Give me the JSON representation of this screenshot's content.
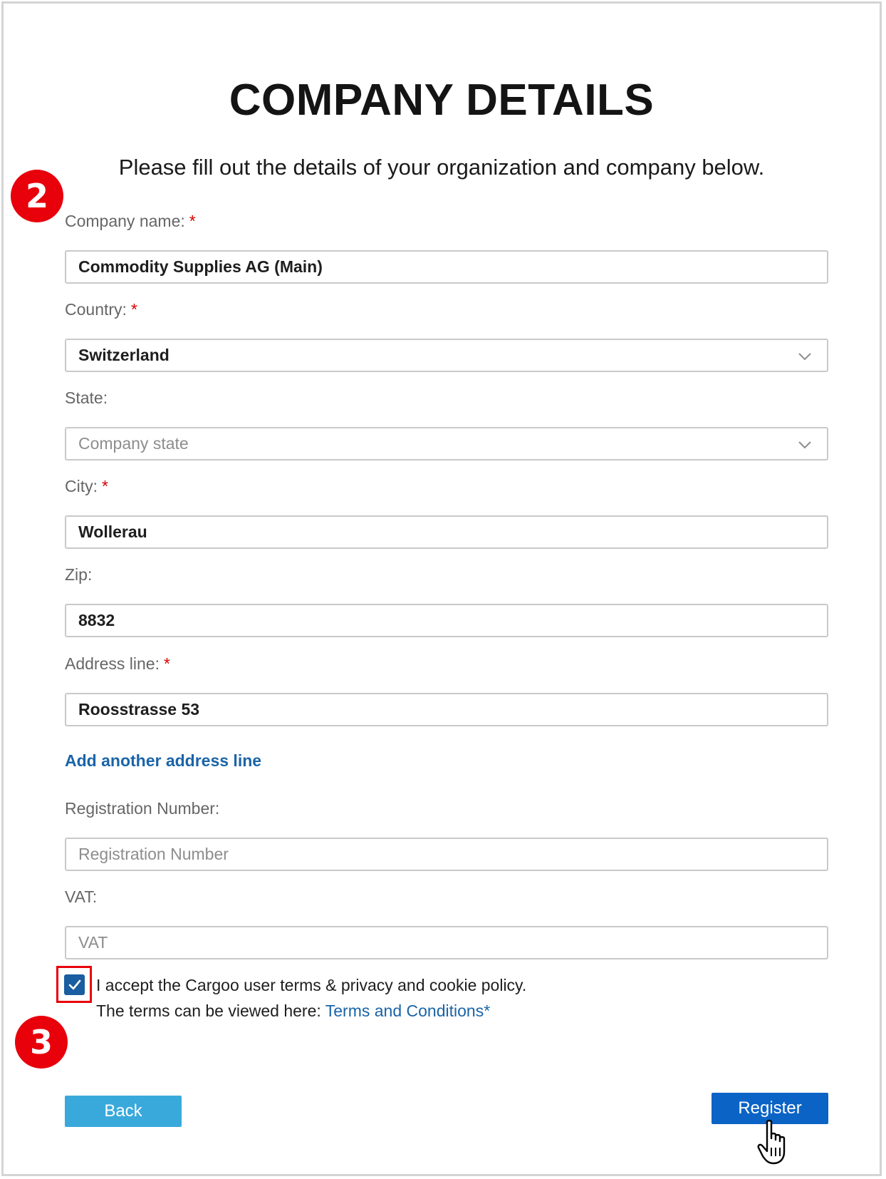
{
  "header": {
    "title": "COMPANY DETAILS",
    "subtitle": "Please fill out the details of your organization and company below."
  },
  "badges": {
    "step_two": "2",
    "step_three": "3"
  },
  "form": {
    "required_mark": "*",
    "company_name": {
      "label": "Company name:",
      "value": "Commodity Supplies AG (Main)"
    },
    "country": {
      "label": "Country:",
      "value": "Switzerland"
    },
    "state": {
      "label": "State:",
      "placeholder": "Company state"
    },
    "city": {
      "label": "City:",
      "value": "Wollerau"
    },
    "zip": {
      "label": "Zip:",
      "value": "8832"
    },
    "address_line": {
      "label": "Address line:",
      "value": "Roosstrasse 53"
    },
    "add_address_link": "Add another address line",
    "registration_number": {
      "label": "Registration Number:",
      "placeholder": "Registration Number"
    },
    "vat": {
      "label": "VAT:",
      "placeholder": "VAT"
    }
  },
  "terms": {
    "checked": true,
    "line1": "I accept the Cargoo user terms & privacy and cookie policy.",
    "line2_prefix": "The terms can be viewed here: ",
    "link_text": "Terms and Conditions*"
  },
  "buttons": {
    "back": "Back",
    "register": "Register"
  },
  "colors": {
    "accent_link": "#1a64a8",
    "badge_red": "#e8000b",
    "back_button": "#39a9dc",
    "register_button": "#0b63c5",
    "checkbox": "#1a5da0"
  },
  "icons": {
    "dropdown": "chevron-down-icon",
    "checkbox": "checkmark-icon",
    "cursor": "hand-pointer-icon"
  }
}
